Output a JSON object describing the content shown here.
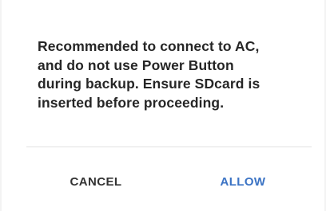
{
  "dialog": {
    "message_lines": [
      "Recommended to connect to AC,",
      "and do not use Power Button",
      "during backup. Ensure SDcard is",
      "inserted before proceeding."
    ],
    "buttons": {
      "cancel_label": "CANCEL",
      "allow_label": "ALLOW"
    },
    "colors": {
      "accent": "#3b73c4",
      "text": "#262626",
      "divider": "#e2e2e2",
      "background": "#ffffff"
    }
  }
}
